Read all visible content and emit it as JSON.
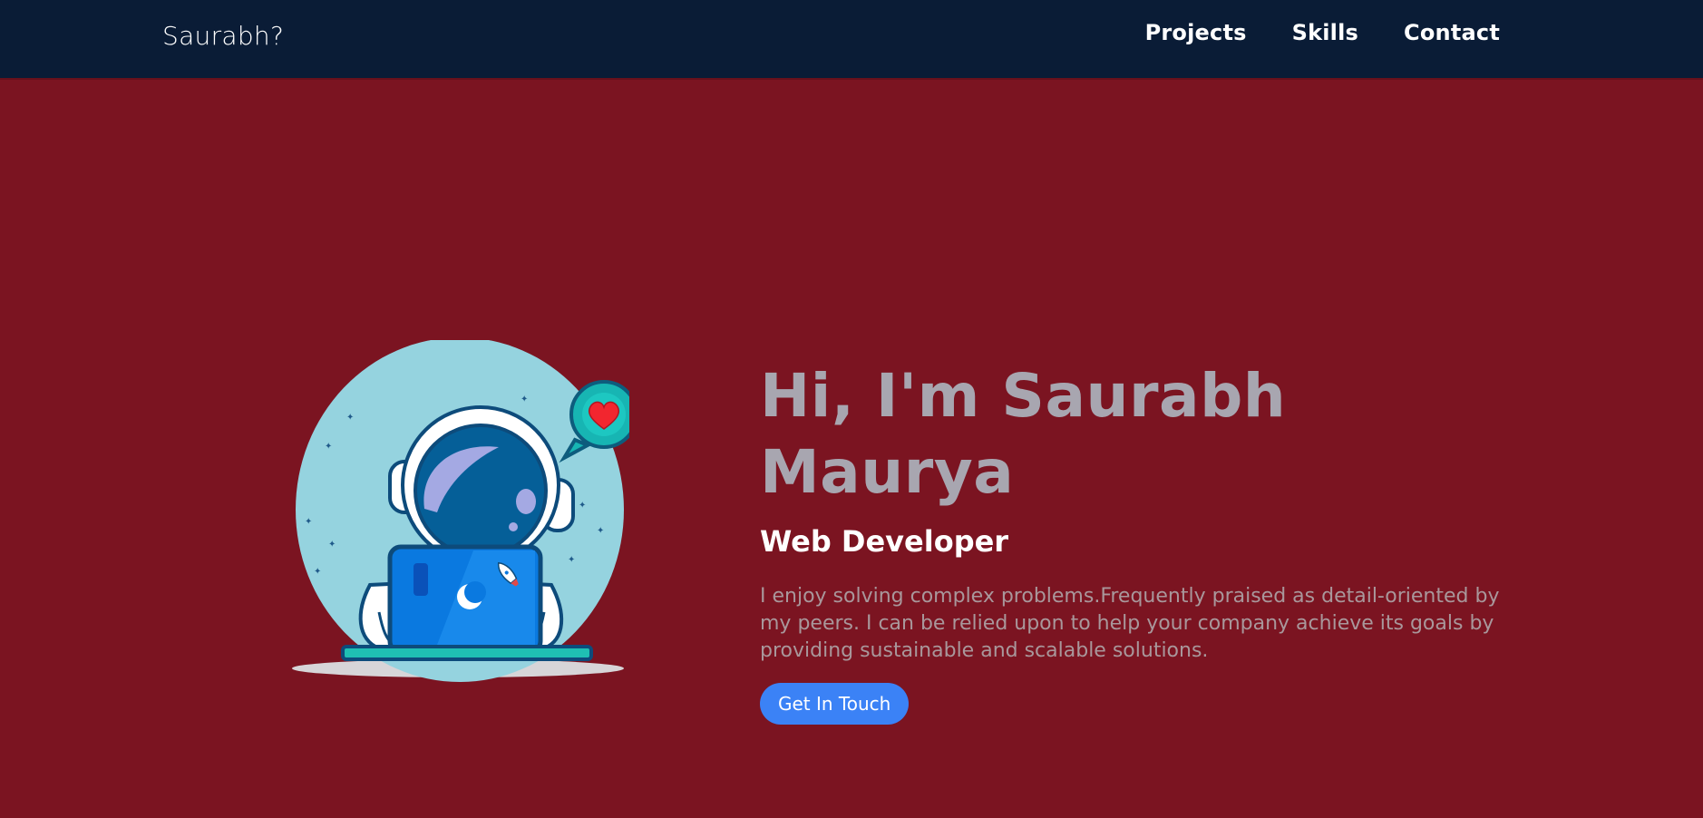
{
  "nav": {
    "brand": "Saurabh?",
    "links": [
      "Projects",
      "Skills",
      "Contact"
    ]
  },
  "hero": {
    "title": "Hi, I'm Saurabh Maurya",
    "role": "Web Developer",
    "description": "I enjoy solving complex problems.Frequently praised as detail-oriented by my peers. I can be relied upon to help your company achieve its goals by providing sustainable and scalable solutions.",
    "cta_label": "Get In Touch"
  },
  "illustration": {
    "icon": "astronaut-laptop-illustration"
  },
  "colors": {
    "navbar_bg": "#0a1c36",
    "page_bg": "#7b1421",
    "title": "#a8a6b0",
    "role": "#ffffff",
    "description": "#a9979b",
    "cta_bg": "#3b82f6"
  }
}
